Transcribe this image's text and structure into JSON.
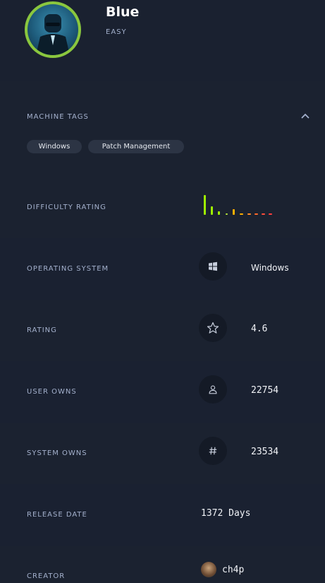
{
  "machine": {
    "name": "Blue",
    "difficulty": "EASY"
  },
  "tags_section": {
    "label": "MACHINE TAGS",
    "tags": [
      "Windows",
      "Patch Management"
    ]
  },
  "difficulty_rating": {
    "label": "DIFFICULTY RATING",
    "level_colors": [
      "#9fef00",
      "#9fef00",
      "#9fef00",
      "#b6e63c",
      "#ffaf00",
      "#ffaf00",
      "#ff8c2a",
      "#ff6a2a",
      "#ff4d3a",
      "#ff3e3e"
    ]
  },
  "stats": [
    {
      "label": "OPERATING SYSTEM",
      "icon": "windows-icon",
      "value": "Windows"
    },
    {
      "label": "RATING",
      "icon": "star-icon",
      "value": "4.6"
    },
    {
      "label": "USER OWNS",
      "icon": "user-icon",
      "value": "22754"
    },
    {
      "label": "SYSTEM OWNS",
      "icon": "hash-icon",
      "value": "23534"
    }
  ],
  "release": {
    "label": "RELEASE DATE",
    "value": "1372 Days"
  },
  "creator": {
    "label": "CREATOR",
    "name": "ch4p"
  }
}
